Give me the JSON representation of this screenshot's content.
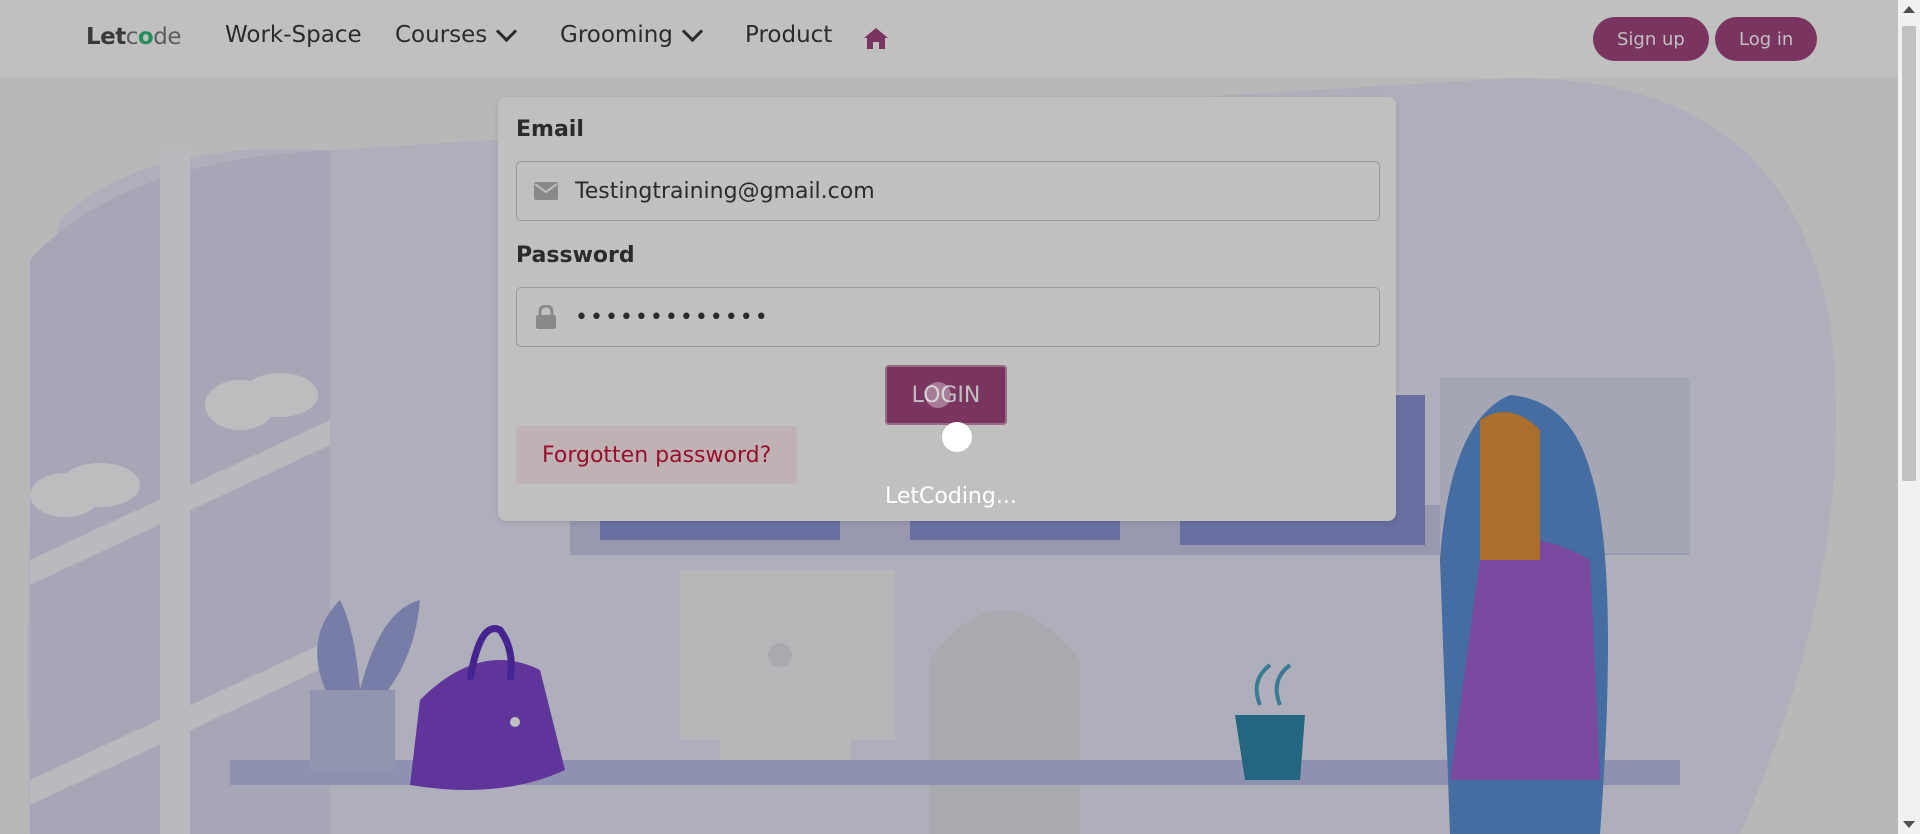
{
  "brand": {
    "prefix": "Let",
    "o": "o",
    "mid": "c",
    "suffix": "de"
  },
  "nav": {
    "workspace": "Work-Space",
    "courses": "Courses",
    "grooming": "Grooming",
    "product": "Product",
    "home_icon": "home-icon"
  },
  "auth": {
    "signup": "Sign up",
    "login": "Log in"
  },
  "form": {
    "email_label": "Email",
    "email_value": "Testingtraining@gmail.com",
    "email_icon": "envelope-icon",
    "password_label": "Password",
    "password_value": "•••••••••••••",
    "password_icon": "lock-icon",
    "login_button": "LOGIN",
    "forgot_button": "Forgotten password?"
  },
  "loader": {
    "text": "LetCoding..."
  },
  "colors": {
    "brand": "#a0437e",
    "forgot_text": "#cc0f35",
    "forgot_bg": "#feecf0"
  }
}
